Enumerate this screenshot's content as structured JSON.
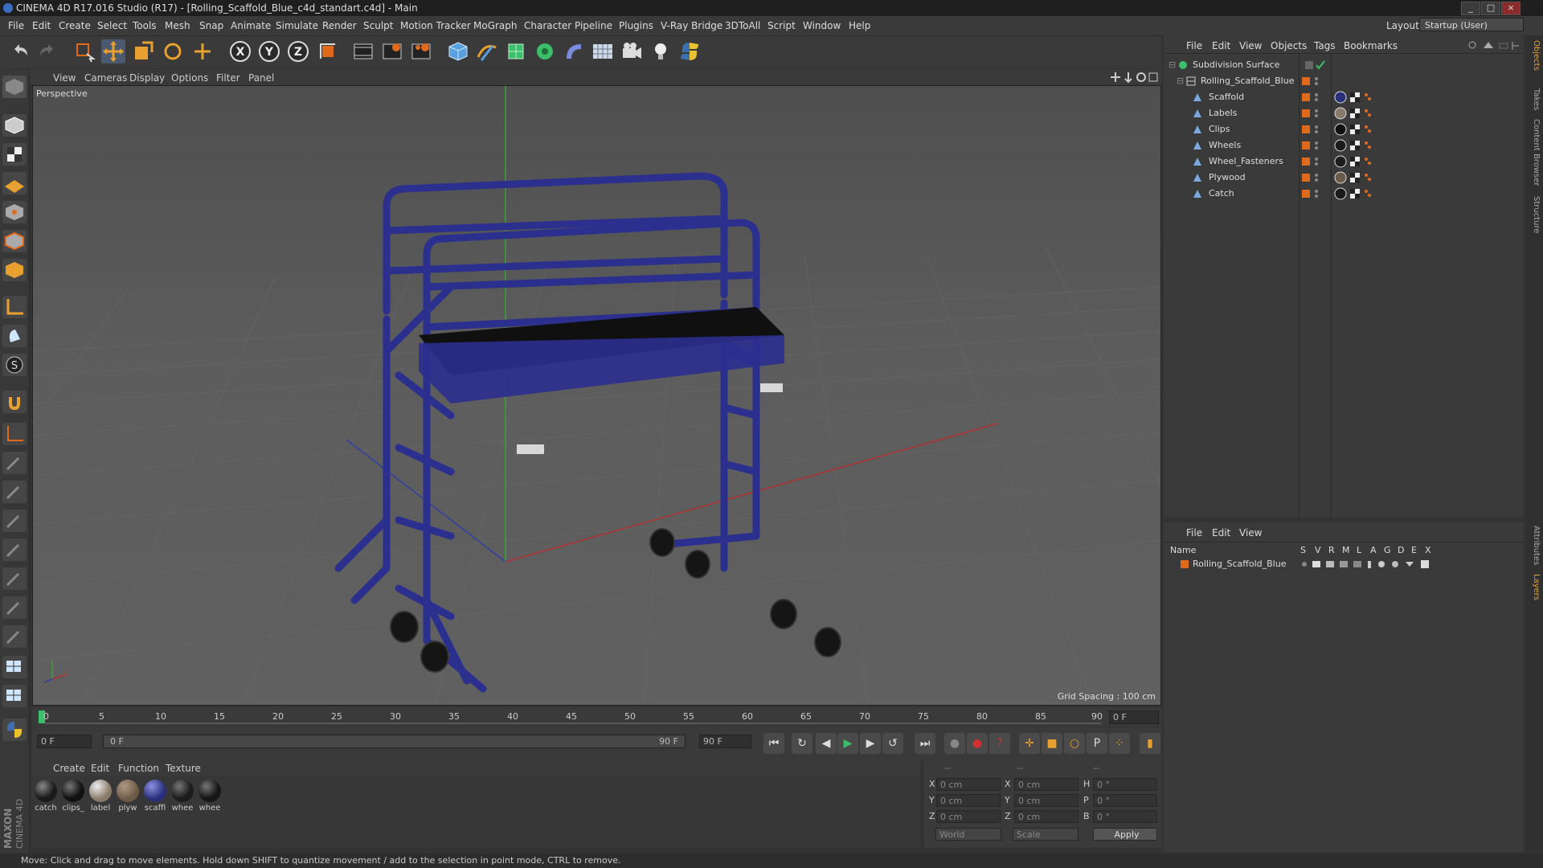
{
  "window": {
    "title": "CINEMA 4D R17.016 Studio (R17) - [Rolling_Scaffold_Blue_c4d_standart.c4d] - Main",
    "controls": [
      "_",
      "□",
      "×"
    ]
  },
  "menubar": {
    "items": [
      "File",
      "Edit",
      "Create",
      "Select",
      "Tools",
      "Mesh",
      "Snap",
      "Animate",
      "Simulate",
      "Render",
      "Sculpt",
      "Motion Tracker",
      "MoGraph",
      "Character",
      "Pipeline",
      "Plugins",
      "V-Ray Bridge",
      "3DToAll",
      "Script",
      "Window",
      "Help"
    ],
    "layout_label": "Layout:",
    "layout_value": "Startup (User)"
  },
  "toolbar": {
    "icons": [
      "undo-icon",
      "redo-icon",
      "live-selection-icon",
      "move-icon",
      "scale-icon",
      "rotate-icon",
      "recent-tool-icon",
      "x-axis-icon",
      "y-axis-icon",
      "z-axis-icon",
      "coordinate-system-icon",
      "render-view-icon",
      "render-picture-viewer-icon",
      "edit-render-settings-icon",
      "cube-icon",
      "pen-spline-icon",
      "subdivision-icon",
      "array-icon",
      "deformer-icon",
      "floor-icon",
      "camera-icon",
      "light-icon",
      "python-icon"
    ],
    "axis_labels": [
      "X",
      "Y",
      "Z"
    ]
  },
  "viewport": {
    "menu": [
      "View",
      "Cameras",
      "Display",
      "Options",
      "Filter",
      "Panel"
    ],
    "label": "Perspective",
    "grid_spacing": "Grid Spacing : 100 cm"
  },
  "timeline": {
    "ticks": [
      "0",
      "5",
      "10",
      "15",
      "20",
      "25",
      "30",
      "35",
      "40",
      "45",
      "50",
      "55",
      "60",
      "65",
      "70",
      "75",
      "80",
      "85",
      "90"
    ],
    "current_frame": "0 F",
    "start_field": "0 F",
    "range_start": "0 F",
    "range_end": "90 F",
    "end_field": "90 F",
    "playback_icons": [
      "goto-start-icon",
      "loop-icon",
      "step-back-icon",
      "play-icon",
      "step-forward-icon",
      "loop-end-icon",
      "goto-end-icon"
    ]
  },
  "materials": {
    "menu": [
      "Create",
      "Edit",
      "Function",
      "Texture"
    ],
    "items": [
      {
        "label": "catch",
        "color": "#1a1a1a"
      },
      {
        "label": "clips_",
        "color": "#111111"
      },
      {
        "label": "label",
        "color": "#8a7a6a"
      },
      {
        "label": "plyw",
        "color": "#6e5a48"
      },
      {
        "label": "scaffi",
        "color": "#2a2f7a"
      },
      {
        "label": "whee",
        "color": "#1c1c1c"
      },
      {
        "label": "whee",
        "color": "#161616"
      }
    ]
  },
  "coordinates": {
    "header": [
      "--",
      "--",
      "--"
    ],
    "rows": [
      {
        "a": "X",
        "av": "0 cm",
        "b": "X",
        "bv": "0 cm",
        "c": "H",
        "cv": "0 °"
      },
      {
        "a": "Y",
        "av": "0 cm",
        "b": "Y",
        "bv": "0 cm",
        "c": "P",
        "cv": "0 °"
      },
      {
        "a": "Z",
        "av": "0 cm",
        "b": "Z",
        "bv": "0 cm",
        "c": "B",
        "cv": "0 °"
      }
    ],
    "world": "World",
    "scale": "Scale",
    "apply": "Apply"
  },
  "objects": {
    "menu": [
      "File",
      "Edit",
      "View",
      "Objects",
      "Tags",
      "Bookmarks"
    ],
    "tree": [
      {
        "name": "Subdivision Surface",
        "indent": 0
      },
      {
        "name": "Rolling_Scaffold_Blue",
        "indent": 1
      },
      {
        "name": "Scaffold",
        "indent": 2,
        "mat": "#2a2f7a"
      },
      {
        "name": "Labels",
        "indent": 2,
        "mat": "#8a7a6a"
      },
      {
        "name": "Clips",
        "indent": 2,
        "mat": "#111111"
      },
      {
        "name": "Wheels",
        "indent": 2,
        "mat": "#1c1c1c"
      },
      {
        "name": "Wheel_Fasteners",
        "indent": 2,
        "mat": "#1c1c1c"
      },
      {
        "name": "Plywood",
        "indent": 2,
        "mat": "#6e5a48"
      },
      {
        "name": "Catch",
        "indent": 2,
        "mat": "#1a1a1a"
      }
    ]
  },
  "layers": {
    "menu": [
      "File",
      "Edit",
      "View"
    ],
    "columns": [
      "Name",
      "S",
      "V",
      "R",
      "M",
      "L",
      "A",
      "G",
      "D",
      "E",
      "X"
    ],
    "rows": [
      "Rolling_Scaffold_Blue"
    ]
  },
  "right_tabs": [
    "Objects",
    "Takes",
    "Content Browser",
    "Structure",
    "Attributes",
    "Layers"
  ],
  "status": "Move: Click and drag to move elements. Hold down SHIFT to quantize movement / add to the selection in point mode, CTRL to remove.",
  "brand": {
    "maxon": "MAXON",
    "c4d": "CINEMA 4D"
  },
  "colors": {
    "accent": "#e06a1b",
    "scaffold": "#2b2f8e",
    "selection": "#c86a1a"
  }
}
